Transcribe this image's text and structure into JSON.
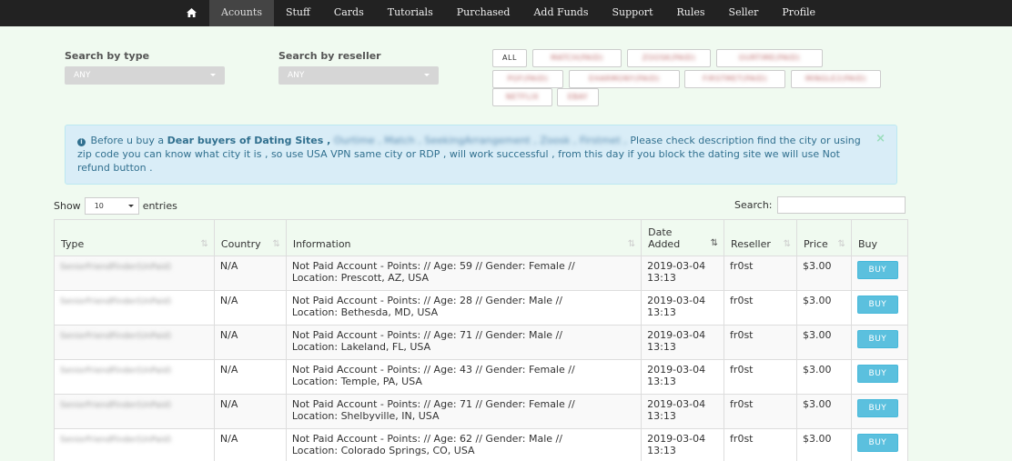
{
  "nav": {
    "home_icon": "home-icon",
    "items": [
      "Acounts",
      "Stuff",
      "Cards",
      "Tutorials",
      "Purchased",
      "Add Funds",
      "Support",
      "Rules",
      "Seller",
      "Profile"
    ]
  },
  "filters": {
    "type_label": "Search by type",
    "type_value": "ANY",
    "reseller_label": "Search by reseller",
    "reseller_value": "ANY",
    "chips": [
      "ALL",
      "MATCH(PAID)",
      "ZOOSK(PAID)",
      "OURTIME(PAID)",
      "POF(PAID)",
      "EHARMONY(PAID)",
      "FIRSTMET(PAID)",
      "MINGLE2(PAID)",
      "NETFLIX",
      "EBAY"
    ]
  },
  "alert": {
    "prefix": "Before u buy a",
    "bold": "Dear buyers of Dating Sites ,",
    "blurred": "Ourtime , Match , SeekingArrangement , Zoosk , Firstmet ,",
    "body": "Please check description find the city or using zip code you can know what city it is , so use USA VPN same city or RDP , will work successful , from this day if you block the dating site we will use Not refund button .",
    "close": "×"
  },
  "table_controls": {
    "show": "Show",
    "length": "10",
    "entries": "entries",
    "search": "Search:"
  },
  "table": {
    "headers": [
      "Type",
      "Country",
      "Information",
      "Date Added",
      "Reseller",
      "Price",
      "Buy"
    ],
    "rows": [
      {
        "type": "SeniorFriendFinder(UnPaid)",
        "country": "N/A",
        "info1": "Not Paid Account - Points: // Age: 59 // Gender: Female //",
        "info2": "Location: Prescott, AZ, USA",
        "date": "2019-03-04",
        "time": "13:13",
        "reseller": "fr0st",
        "price": "$3.00",
        "buy": "BUY"
      },
      {
        "type": "SeniorFriendFinder(UnPaid)",
        "country": "N/A",
        "info1": "Not Paid Account - Points: // Age: 28 // Gender: Male //",
        "info2": "Location: Bethesda, MD, USA",
        "date": "2019-03-04",
        "time": "13:13",
        "reseller": "fr0st",
        "price": "$3.00",
        "buy": "BUY"
      },
      {
        "type": "SeniorFriendFinder(UnPaid)",
        "country": "N/A",
        "info1": "Not Paid Account - Points: // Age: 71 // Gender: Male //",
        "info2": "Location: Lakeland, FL, USA",
        "date": "2019-03-04",
        "time": "13:13",
        "reseller": "fr0st",
        "price": "$3.00",
        "buy": "BUY"
      },
      {
        "type": "SeniorFriendFinder(UnPaid)",
        "country": "N/A",
        "info1": "Not Paid Account - Points: // Age: 43 // Gender: Female //",
        "info2": "Location: Temple, PA, USA",
        "date": "2019-03-04",
        "time": "13:13",
        "reseller": "fr0st",
        "price": "$3.00",
        "buy": "BUY"
      },
      {
        "type": "SeniorFriendFinder(UnPaid)",
        "country": "N/A",
        "info1": "Not Paid Account - Points: // Age: 71 // Gender: Female //",
        "info2": "Location: Shelbyville, IN, USA",
        "date": "2019-03-04",
        "time": "13:13",
        "reseller": "fr0st",
        "price": "$3.00",
        "buy": "BUY"
      },
      {
        "type": "SeniorFriendFinder(UnPaid)",
        "country": "N/A",
        "info1": "Not Paid Account - Points: // Age: 62 // Gender: Male //",
        "info2": "Location: Colorado Springs, CO, USA",
        "date": "2019-03-04",
        "time": "13:13",
        "reseller": "fr0st",
        "price": "$3.00",
        "buy": "BUY"
      }
    ]
  },
  "colors": {
    "navbar": "#222222",
    "page_bg": "#f0faf0",
    "alert_bg": "#d9edf7",
    "buy_button": "#5bc0de"
  }
}
